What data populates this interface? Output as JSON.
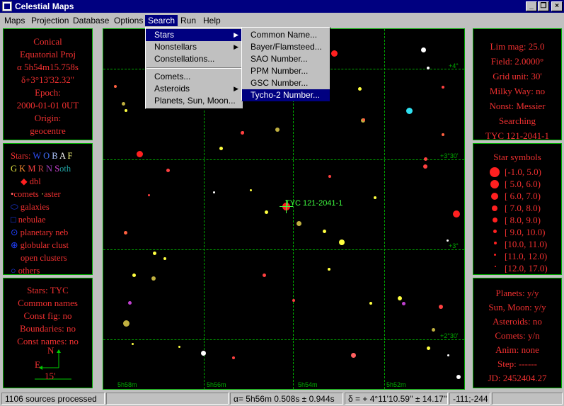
{
  "window": {
    "title": "Celestial Maps"
  },
  "menu": [
    "Maps",
    "Projection",
    "Database",
    "Options",
    "Search",
    "Run",
    "Help"
  ],
  "search_menu": {
    "items": [
      "Stars",
      "Nonstellars",
      "Constellations...",
      "Comets...",
      "Asteroids",
      "Planets, Sun, Moon..."
    ]
  },
  "stars_submenu": {
    "items": [
      "Common Name...",
      "Bayer/Flamsteed...",
      "SAO Number...",
      "PPM Number...",
      "GSC Number...",
      "Tycho-2 Number..."
    ]
  },
  "left_top": {
    "lines": [
      "Conical",
      "Equatorial Proj",
      "α 5h54m15.758s",
      "δ+3°13'32.32\"",
      "Epoch:",
      "2000-01-01 0UT",
      "Origin:",
      "geocentre"
    ]
  },
  "left_mid": {
    "stars_label": "Stars:",
    "spectral": [
      "W",
      "O",
      "B",
      "A",
      "F",
      "G",
      "K",
      "M",
      "R",
      "N",
      "S",
      "oth"
    ],
    "items": [
      "dbl",
      "comets",
      "aster",
      "galaxies",
      "nebulae",
      "planetary neb",
      "globular clust",
      "open clusters",
      "others"
    ]
  },
  "left_bottom": {
    "lines": [
      "Stars: TYC",
      "Common names",
      "Const fig: no",
      "Boundaries: no",
      "Const names: no"
    ],
    "compass_n": "N",
    "compass_e": "E",
    "scale": "15'"
  },
  "right_top": {
    "lines": [
      "Lim mag: 25.0",
      "Field:  2.0000°",
      "Grid unit:  30'",
      "Milky Way: no",
      "Nonst: Messier",
      "Searching",
      "TYC 121-2041-1"
    ]
  },
  "right_mid": {
    "title": "Star symbols",
    "ranges": [
      "[-1.0,  5.0)",
      "[ 5.0,  6.0)",
      "[ 6.0,  7.0)",
      "[ 7.0,  8.0)",
      "[ 8.0,  9.0)",
      "[ 9.0, 10.0)",
      "[10.0, 11.0)",
      "[11.0, 12.0)",
      "[12.0, 17.0)"
    ]
  },
  "right_bottom": {
    "lines": [
      "Planets: y/y",
      "Sun, Moon: y/y",
      "Asteroids: no",
      "Comets: y/n",
      "Anim: none",
      "Step: ------",
      "JD: 2452404.27"
    ]
  },
  "map": {
    "target_label": "TYC 121-2041-1",
    "dec_labels": [
      "+4°",
      "+3°30'",
      "+3°",
      "+2°30'"
    ],
    "ra_labels": [
      "5h58m",
      "5h56m",
      "5h54m",
      "5h52m"
    ]
  },
  "status": {
    "sources": "1106 sources processed",
    "alpha": "α=  5h56m 0.508s ± 0.944s",
    "delta": "δ = + 4°11'10.59'' ± 14.17''",
    "xy": "-111;-244"
  },
  "colors": {
    "panel_text": "#f03030",
    "grid": "#00aa00",
    "menu_highlight": "#000080"
  }
}
